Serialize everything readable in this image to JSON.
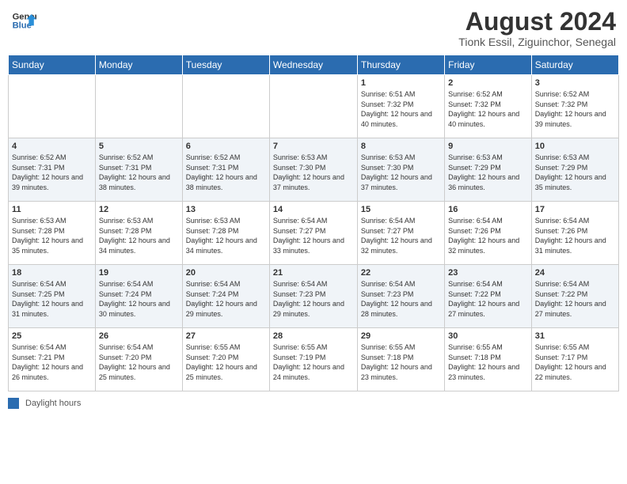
{
  "header": {
    "logo_line1": "General",
    "logo_line2": "Blue",
    "month_year": "August 2024",
    "location": "Tionk Essil, Ziguinchor, Senegal"
  },
  "days_of_week": [
    "Sunday",
    "Monday",
    "Tuesday",
    "Wednesday",
    "Thursday",
    "Friday",
    "Saturday"
  ],
  "footer_legend": "Daylight hours",
  "weeks": [
    [
      {
        "day": "",
        "sunrise": "",
        "sunset": "",
        "daylight": ""
      },
      {
        "day": "",
        "sunrise": "",
        "sunset": "",
        "daylight": ""
      },
      {
        "day": "",
        "sunrise": "",
        "sunset": "",
        "daylight": ""
      },
      {
        "day": "",
        "sunrise": "",
        "sunset": "",
        "daylight": ""
      },
      {
        "day": "1",
        "sunrise": "Sunrise: 6:51 AM",
        "sunset": "Sunset: 7:32 PM",
        "daylight": "Daylight: 12 hours and 40 minutes."
      },
      {
        "day": "2",
        "sunrise": "Sunrise: 6:52 AM",
        "sunset": "Sunset: 7:32 PM",
        "daylight": "Daylight: 12 hours and 40 minutes."
      },
      {
        "day": "3",
        "sunrise": "Sunrise: 6:52 AM",
        "sunset": "Sunset: 7:32 PM",
        "daylight": "Daylight: 12 hours and 39 minutes."
      }
    ],
    [
      {
        "day": "4",
        "sunrise": "Sunrise: 6:52 AM",
        "sunset": "Sunset: 7:31 PM",
        "daylight": "Daylight: 12 hours and 39 minutes."
      },
      {
        "day": "5",
        "sunrise": "Sunrise: 6:52 AM",
        "sunset": "Sunset: 7:31 PM",
        "daylight": "Daylight: 12 hours and 38 minutes."
      },
      {
        "day": "6",
        "sunrise": "Sunrise: 6:52 AM",
        "sunset": "Sunset: 7:31 PM",
        "daylight": "Daylight: 12 hours and 38 minutes."
      },
      {
        "day": "7",
        "sunrise": "Sunrise: 6:53 AM",
        "sunset": "Sunset: 7:30 PM",
        "daylight": "Daylight: 12 hours and 37 minutes."
      },
      {
        "day": "8",
        "sunrise": "Sunrise: 6:53 AM",
        "sunset": "Sunset: 7:30 PM",
        "daylight": "Daylight: 12 hours and 37 minutes."
      },
      {
        "day": "9",
        "sunrise": "Sunrise: 6:53 AM",
        "sunset": "Sunset: 7:29 PM",
        "daylight": "Daylight: 12 hours and 36 minutes."
      },
      {
        "day": "10",
        "sunrise": "Sunrise: 6:53 AM",
        "sunset": "Sunset: 7:29 PM",
        "daylight": "Daylight: 12 hours and 35 minutes."
      }
    ],
    [
      {
        "day": "11",
        "sunrise": "Sunrise: 6:53 AM",
        "sunset": "Sunset: 7:28 PM",
        "daylight": "Daylight: 12 hours and 35 minutes."
      },
      {
        "day": "12",
        "sunrise": "Sunrise: 6:53 AM",
        "sunset": "Sunset: 7:28 PM",
        "daylight": "Daylight: 12 hours and 34 minutes."
      },
      {
        "day": "13",
        "sunrise": "Sunrise: 6:53 AM",
        "sunset": "Sunset: 7:28 PM",
        "daylight": "Daylight: 12 hours and 34 minutes."
      },
      {
        "day": "14",
        "sunrise": "Sunrise: 6:54 AM",
        "sunset": "Sunset: 7:27 PM",
        "daylight": "Daylight: 12 hours and 33 minutes."
      },
      {
        "day": "15",
        "sunrise": "Sunrise: 6:54 AM",
        "sunset": "Sunset: 7:27 PM",
        "daylight": "Daylight: 12 hours and 32 minutes."
      },
      {
        "day": "16",
        "sunrise": "Sunrise: 6:54 AM",
        "sunset": "Sunset: 7:26 PM",
        "daylight": "Daylight: 12 hours and 32 minutes."
      },
      {
        "day": "17",
        "sunrise": "Sunrise: 6:54 AM",
        "sunset": "Sunset: 7:26 PM",
        "daylight": "Daylight: 12 hours and 31 minutes."
      }
    ],
    [
      {
        "day": "18",
        "sunrise": "Sunrise: 6:54 AM",
        "sunset": "Sunset: 7:25 PM",
        "daylight": "Daylight: 12 hours and 31 minutes."
      },
      {
        "day": "19",
        "sunrise": "Sunrise: 6:54 AM",
        "sunset": "Sunset: 7:24 PM",
        "daylight": "Daylight: 12 hours and 30 minutes."
      },
      {
        "day": "20",
        "sunrise": "Sunrise: 6:54 AM",
        "sunset": "Sunset: 7:24 PM",
        "daylight": "Daylight: 12 hours and 29 minutes."
      },
      {
        "day": "21",
        "sunrise": "Sunrise: 6:54 AM",
        "sunset": "Sunset: 7:23 PM",
        "daylight": "Daylight: 12 hours and 29 minutes."
      },
      {
        "day": "22",
        "sunrise": "Sunrise: 6:54 AM",
        "sunset": "Sunset: 7:23 PM",
        "daylight": "Daylight: 12 hours and 28 minutes."
      },
      {
        "day": "23",
        "sunrise": "Sunrise: 6:54 AM",
        "sunset": "Sunset: 7:22 PM",
        "daylight": "Daylight: 12 hours and 27 minutes."
      },
      {
        "day": "24",
        "sunrise": "Sunrise: 6:54 AM",
        "sunset": "Sunset: 7:22 PM",
        "daylight": "Daylight: 12 hours and 27 minutes."
      }
    ],
    [
      {
        "day": "25",
        "sunrise": "Sunrise: 6:54 AM",
        "sunset": "Sunset: 7:21 PM",
        "daylight": "Daylight: 12 hours and 26 minutes."
      },
      {
        "day": "26",
        "sunrise": "Sunrise: 6:54 AM",
        "sunset": "Sunset: 7:20 PM",
        "daylight": "Daylight: 12 hours and 25 minutes."
      },
      {
        "day": "27",
        "sunrise": "Sunrise: 6:55 AM",
        "sunset": "Sunset: 7:20 PM",
        "daylight": "Daylight: 12 hours and 25 minutes."
      },
      {
        "day": "28",
        "sunrise": "Sunrise: 6:55 AM",
        "sunset": "Sunset: 7:19 PM",
        "daylight": "Daylight: 12 hours and 24 minutes."
      },
      {
        "day": "29",
        "sunrise": "Sunrise: 6:55 AM",
        "sunset": "Sunset: 7:18 PM",
        "daylight": "Daylight: 12 hours and 23 minutes."
      },
      {
        "day": "30",
        "sunrise": "Sunrise: 6:55 AM",
        "sunset": "Sunset: 7:18 PM",
        "daylight": "Daylight: 12 hours and 23 minutes."
      },
      {
        "day": "31",
        "sunrise": "Sunrise: 6:55 AM",
        "sunset": "Sunset: 7:17 PM",
        "daylight": "Daylight: 12 hours and 22 minutes."
      }
    ]
  ]
}
